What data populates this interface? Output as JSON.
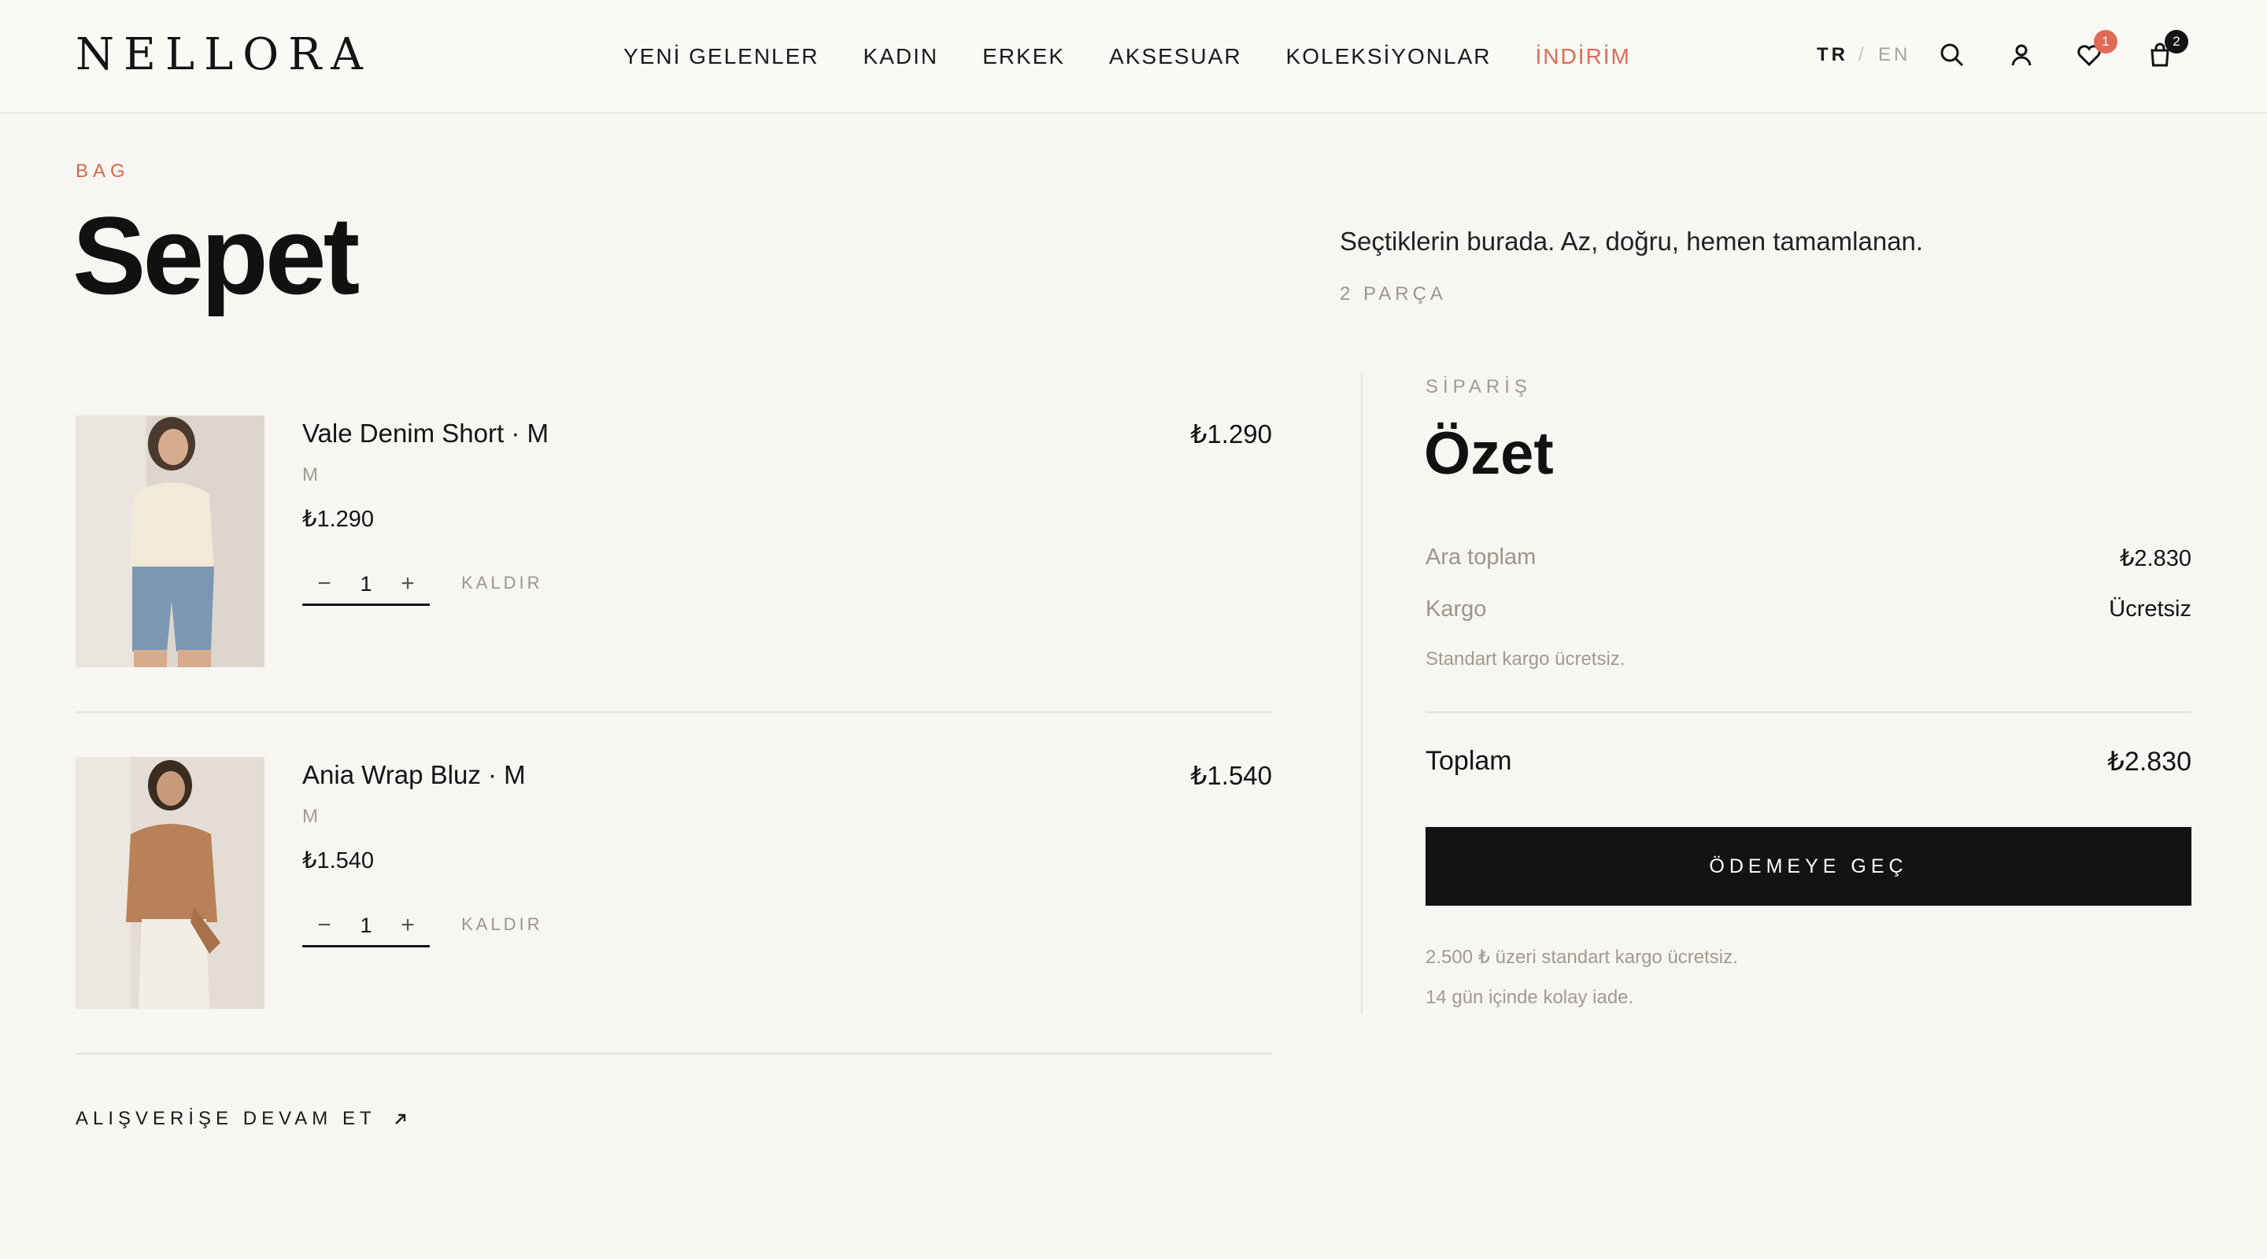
{
  "header": {
    "logo": "NELLORA",
    "nav": [
      "YENİ GELENLER",
      "KADIN",
      "ERKEK",
      "AKSESUAR",
      "KOLEKSİYONLAR",
      "İNDİRİM"
    ],
    "lang": {
      "active": "TR",
      "separator": "/",
      "other": "EN"
    },
    "wishlist_count": "1",
    "bag_count": "2",
    "icons": [
      "search-icon",
      "user-icon",
      "heart-icon",
      "bag-icon"
    ],
    "colors": {
      "sale": "#e06a55",
      "accent": "#cf6a4e"
    }
  },
  "page": {
    "eyebrow": "BAG",
    "title": "Sepet",
    "tagline": "Seçtiklerin burada. Az, doğru, hemen tamamlanan.",
    "count": "2 PARÇA"
  },
  "cart": {
    "items": [
      {
        "name": "Vale Denim Short · M",
        "variant": "M",
        "price": "₺1.290",
        "line_total": "₺1.290",
        "qty": "1",
        "remove": "KALDIR"
      },
      {
        "name": "Ania Wrap Bluz · M",
        "variant": "M",
        "price": "₺1.540",
        "line_total": "₺1.540",
        "qty": "1",
        "remove": "KALDIR"
      }
    ],
    "continue_label": "ALIŞVERİŞE DEVAM ET"
  },
  "summary": {
    "eyebrow": "SİPARİŞ",
    "title": "Özet",
    "subtotal_label": "Ara toplam",
    "subtotal": "₺2.830",
    "shipping_label": "Kargo",
    "shipping": "Ücretsiz",
    "shipping_note": "Standart kargo ücretsiz.",
    "total_label": "Toplam",
    "total": "₺2.830",
    "checkout_label": "ÖDEMEYE GEÇ",
    "note_1": "2.500 ₺ üzeri standart kargo ücretsiz.",
    "note_2": "14 gün içinde kolay iade."
  }
}
